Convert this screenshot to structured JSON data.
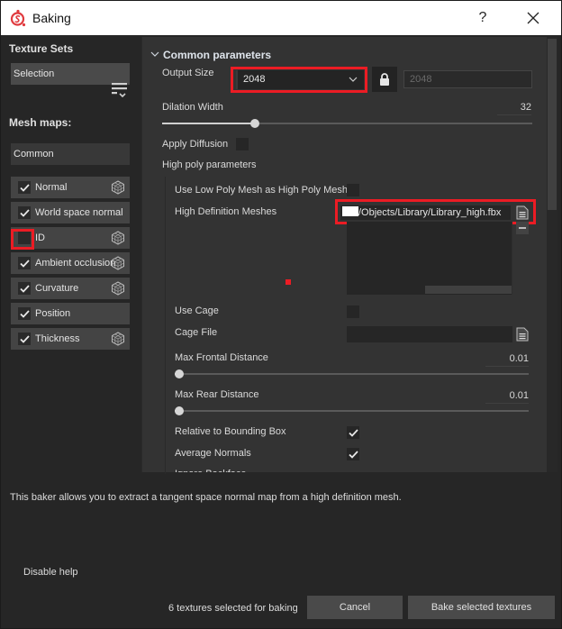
{
  "window": {
    "title": "Baking",
    "help_label": "?",
    "icons": {
      "app": "substance-logo-icon",
      "close": "close-icon"
    }
  },
  "left_panel": {
    "texture_sets_label": "Texture Sets",
    "texture_set_selection": "Selection",
    "mesh_maps_label": "Mesh maps:",
    "mesh_maps_group": "Common",
    "mesh_maps": [
      {
        "label": "Normal",
        "checked": true,
        "has_cube_icon": true
      },
      {
        "label": "World space normal",
        "checked": true,
        "has_cube_icon": false
      },
      {
        "label": "ID",
        "checked": false,
        "has_cube_icon": true
      },
      {
        "label": "Ambient occlusion",
        "checked": true,
        "has_cube_icon": true
      },
      {
        "label": "Curvature",
        "checked": true,
        "has_cube_icon": true
      },
      {
        "label": "Position",
        "checked": true,
        "has_cube_icon": false
      },
      {
        "label": "Thickness",
        "checked": true,
        "has_cube_icon": true
      }
    ]
  },
  "common_parameters": {
    "header": "Common parameters",
    "output_size_label": "Output Size",
    "output_size_value": "2048",
    "output_size_linked_value": "2048",
    "dilation_width_label": "Dilation Width",
    "dilation_width_value": "32",
    "dilation_width_fraction": 0.25,
    "apply_diffusion_label": "Apply Diffusion",
    "apply_diffusion_checked": false,
    "high_poly_label": "High poly parameters",
    "use_low_poly_label": "Use Low Poly Mesh as High Poly Mesh",
    "use_low_poly_checked": false,
    "hd_meshes_label": "High Definition Meshes",
    "hd_mesh_path": "/Objects/Library/Library_high.fbx",
    "use_cage_label": "Use Cage",
    "use_cage_checked": false,
    "cage_file_label": "Cage File",
    "cage_file_value": "",
    "max_frontal_label": "Max Frontal Distance",
    "max_frontal_value": "0.01",
    "max_frontal_fraction": 0.01,
    "max_rear_label": "Max Rear Distance",
    "max_rear_value": "0.01",
    "max_rear_fraction": 0.01,
    "relative_bbox_label": "Relative to Bounding Box",
    "relative_bbox_checked": true,
    "average_normals_label": "Average Normals",
    "average_normals_checked": true,
    "partial_next_label": "Ignore Backface"
  },
  "footer": {
    "help_text": "This baker allows you to extract a tangent space normal map from a high definition mesh.",
    "disable_help_label": "Disable help",
    "selected_count_text": "6 textures selected for baking",
    "cancel_label": "Cancel",
    "bake_label": "Bake selected textures"
  },
  "colors": {
    "highlight_red": "#ec1c24",
    "panel_bg": "#333333",
    "window_bg": "#262626"
  }
}
